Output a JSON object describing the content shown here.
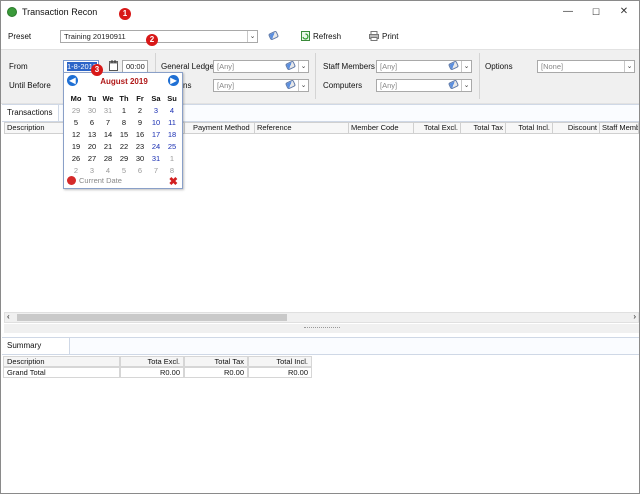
{
  "window": {
    "title": "Transaction Recon",
    "minimize": "—",
    "maximize": "☐",
    "close": "✕"
  },
  "badges": [
    "1",
    "2",
    "3"
  ],
  "preset": {
    "label": "Preset",
    "value": "Training 20190911",
    "refresh": "Refresh",
    "print": "Print"
  },
  "filters": {
    "from_label": "From",
    "from_date": "1-8-2019",
    "from_time": "00:00",
    "until_label": "Until Before",
    "general_ledgers_label": "General Ledgers",
    "general_ledgers_value": "[Any]",
    "row2_mid_label": "ns",
    "row2_mid_value": "[Any]",
    "staff_label": "Staff Members",
    "staff_value": "[Any]",
    "computers_label": "Computers",
    "computers_value": "[Any]",
    "options_label": "Options",
    "options_value": "[None]"
  },
  "transactions": {
    "tab": "Transactions",
    "columns": [
      "Description",
      "Payment Method",
      "Reference",
      "Member Code",
      "Total Excl.",
      "Total Tax",
      "Total Incl.",
      "Discount",
      "Staff Membe"
    ]
  },
  "calendar": {
    "month": "August 2019",
    "prev": "◀",
    "next": "▶",
    "dow": [
      "Mo",
      "Tu",
      "We",
      "Th",
      "Fr",
      "Sa",
      "Su"
    ],
    "weeks": [
      [
        "29",
        "30",
        "31",
        "1",
        "2",
        "3",
        "4"
      ],
      [
        "5",
        "6",
        "7",
        "8",
        "9",
        "10",
        "11"
      ],
      [
        "12",
        "13",
        "14",
        "15",
        "16",
        "17",
        "18"
      ],
      [
        "19",
        "20",
        "21",
        "22",
        "23",
        "24",
        "25"
      ],
      [
        "26",
        "27",
        "28",
        "29",
        "30",
        "31",
        "1"
      ],
      [
        "2",
        "3",
        "4",
        "5",
        "6",
        "7",
        "8"
      ]
    ],
    "current_date": "Current Date",
    "close": "✖"
  },
  "summary": {
    "tab": "Summary",
    "columns": [
      "Description",
      "Tota Excl.",
      "Total Tax",
      "Total Incl."
    ],
    "rows": [
      [
        "Grand Total",
        "R0.00",
        "R0.00",
        "R0.00"
      ]
    ]
  }
}
